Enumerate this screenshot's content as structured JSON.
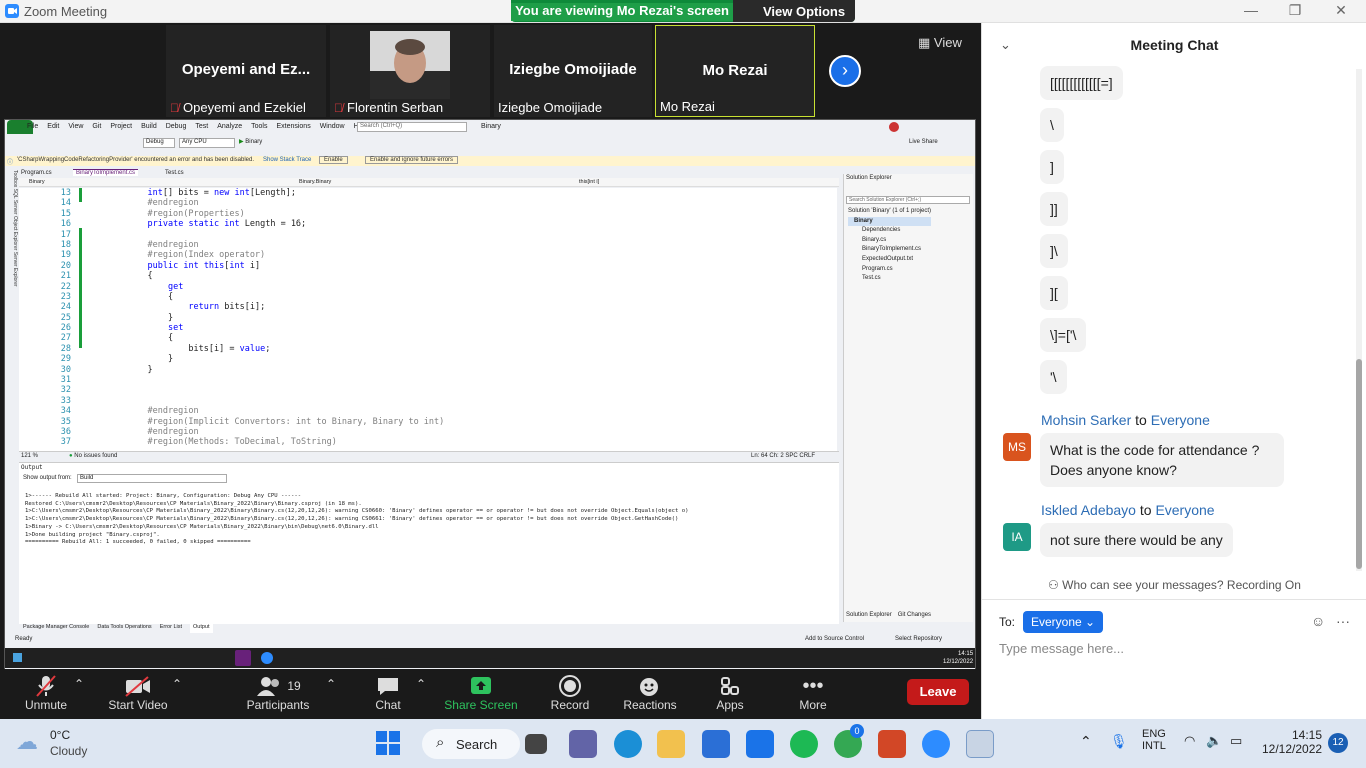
{
  "titlebar": {
    "app_title": "Zoom Meeting",
    "banner_text": "You are viewing Mo Rezai's screen",
    "view_options": "View Options"
  },
  "participants_strip": [
    {
      "name_big": "Opeyemi  and  Ez...",
      "label": "Opeyemi and Ezekiel",
      "muted": true
    },
    {
      "name_big": "",
      "label": "Florentin Serban",
      "muted": true
    },
    {
      "name_big": "Iziegbe Omoijiade",
      "label": "Iziegbe Omoijiade",
      "muted": false
    },
    {
      "name_big": "Mo Rezai",
      "label": "Mo Rezai",
      "muted": false
    }
  ],
  "strip_view_label": "View",
  "vs": {
    "menu": [
      "File",
      "Edit",
      "View",
      "Git",
      "Project",
      "Build",
      "Debug",
      "Test",
      "Analyze",
      "Tools",
      "Extensions",
      "Window",
      "Help"
    ],
    "search_placeholder": "Search (Ctrl+Q)",
    "solution_name": "Binary",
    "config": "Debug",
    "platform": "Any CPU",
    "run_target": "Binary",
    "live_share": "Live Share",
    "warning": "'CSharpWrappingCodeRefactoringProvider' encountered an error and has been disabled.",
    "warning_link1": "Show Stack Trace",
    "warning_btn1": "Enable",
    "warning_btn2": "Enable and ignore future errors",
    "tabs": [
      "Program.cs",
      "BinaryToImplement.cs",
      "Test.cs"
    ],
    "nav_left": "Binary",
    "nav_mid": "Binary.Binary",
    "nav_right": "this[int i]",
    "side_tabs": "Toolbox  SQL Server Object Explorer  Server Explorer",
    "code_lines": [
      {
        "n": "13",
        "t": "    int[] bits = new int[Length];"
      },
      {
        "n": "14",
        "t": "    #endregion"
      },
      {
        "n": "15",
        "t": "    #region(Properties)"
      },
      {
        "n": "16",
        "t": "    private static int Length = 16;"
      },
      {
        "n": "17",
        "t": ""
      },
      {
        "n": "18",
        "t": "    #endregion"
      },
      {
        "n": "19",
        "t": "    #region(Index operator)"
      },
      {
        "n": "20",
        "t": "    public int this[int i]"
      },
      {
        "n": "21",
        "t": "    {"
      },
      {
        "n": "22",
        "t": "        get"
      },
      {
        "n": "23",
        "t": "        {"
      },
      {
        "n": "24",
        "t": "            return bits[i];"
      },
      {
        "n": "25",
        "t": "        }"
      },
      {
        "n": "26",
        "t": "        set"
      },
      {
        "n": "27",
        "t": "        {"
      },
      {
        "n": "28",
        "t": "            bits[i] = value;"
      },
      {
        "n": "29",
        "t": "        }"
      },
      {
        "n": "30",
        "t": "    }"
      },
      {
        "n": "31",
        "t": ""
      },
      {
        "n": "32",
        "t": ""
      },
      {
        "n": "33",
        "t": ""
      },
      {
        "n": "34",
        "t": "    #endregion"
      },
      {
        "n": "35",
        "t": "    #region(Implicit Convertors: int to Binary, Binary to int)"
      },
      {
        "n": "36",
        "t": "    #endregion"
      },
      {
        "n": "37",
        "t": "    #region(Methods: ToDecimal, ToString)"
      }
    ],
    "editor_zoom": "121 %",
    "editor_issues": "No issues found",
    "editor_pos": "Ln: 64    Ch: 2    SPC    CRLF",
    "output_title": "Output",
    "output_from_label": "Show output from:",
    "output_from": "Build",
    "output_lines": [
      "1>------ Rebuild All started: Project: Binary, Configuration: Debug Any CPU ------",
      "Restored C:\\Users\\cmsmr2\\Desktop\\Resources\\CP Materials\\Binary_2022\\Binary\\Binary.csproj (in 18 ms).",
      "1>C:\\Users\\cmsmr2\\Desktop\\Resources\\CP Materials\\Binary_2022\\Binary\\Binary.cs(12,20,12,26): warning CS0660: 'Binary' defines operator == or operator != but does not override Object.Equals(object o)",
      "1>C:\\Users\\cmsmr2\\Desktop\\Resources\\CP Materials\\Binary_2022\\Binary\\Binary.cs(12,20,12,26): warning CS0661: 'Binary' defines operator == or operator != but does not override Object.GetHashCode()",
      "1>Binary -> C:\\Users\\cmsmr2\\Desktop\\Resources\\CP Materials\\Binary_2022\\Binary\\bin\\Debug\\net6.0\\Binary.dll",
      "1>Done building project \"Binary.csproj\".",
      "========== Rebuild All: 1 succeeded, 0 failed, 0 skipped =========="
    ],
    "bottom_tabs": [
      "Package Manager Console",
      "Data Tools Operations",
      "Error List",
      "Output"
    ],
    "sol_title": "Solution Explorer",
    "sol_search": "Search Solution Explorer (Ctrl+;)",
    "sol_items": [
      "Solution 'Binary' (1 of 1 project)",
      "Binary",
      "Dependencies",
      "Binary.cs",
      "BinaryToImplement.cs",
      "ExpectedOutput.txt",
      "Program.cs",
      "Test.cs"
    ],
    "sol_tabs": [
      "Solution Explorer",
      "Git Changes"
    ],
    "status_ready": "Ready",
    "status_source": "Add to Source Control",
    "status_repo": "Select Repository",
    "remote_time": "14:15",
    "remote_date": "12/12/2022"
  },
  "toolbar": {
    "unmute": "Unmute",
    "start_video": "Start Video",
    "participants": "Participants",
    "participants_count": "19",
    "chat": "Chat",
    "share": "Share Screen",
    "record": "Record",
    "reactions": "Reactions",
    "apps": "Apps",
    "more": "More",
    "leave": "Leave"
  },
  "chat": {
    "title": "Meeting Chat",
    "bubbles": [
      "[[[[[[[[[[[[[=]",
      "\\",
      "]",
      "]]",
      "]\\",
      "][",
      "\\]=['\\",
      "'\\"
    ],
    "messages": [
      {
        "sender": "Mohsin Sarker",
        "to": "to",
        "recipient": "Everyone",
        "initials": "MS",
        "text": "What is the code for attendance ? Does anyone know?"
      },
      {
        "sender": "Iskled Adebayo",
        "to": "to",
        "recipient": "Everyone",
        "initials": "IA",
        "text": "not sure there would be any"
      }
    ],
    "visibility": "Who can see your messages? Recording On",
    "to_label": "To:",
    "to_value": "Everyone",
    "input_placeholder": "Type message here..."
  },
  "taskbar": {
    "temp": "0°C",
    "weather": "Cloudy",
    "search": "Search",
    "lang1": "ENG",
    "lang2": "INTL",
    "time": "14:15",
    "date": "12/12/2022",
    "notif": "12",
    "badge": "0"
  }
}
